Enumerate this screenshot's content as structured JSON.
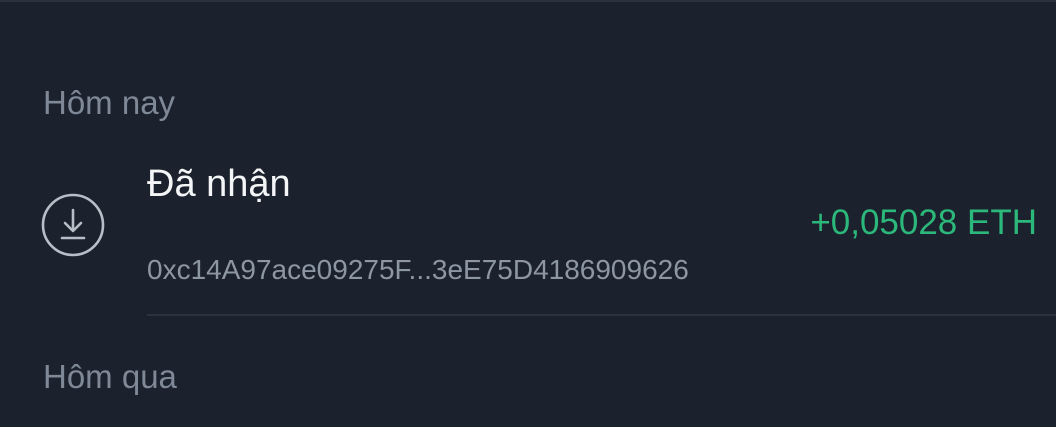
{
  "sections": {
    "today": "Hôm nay",
    "yesterday": "Hôm qua"
  },
  "transaction": {
    "type": "Đã nhận",
    "address": "0xc14A97ace09275F...3eE75D4186909626",
    "amount": "+0,05028 ETH",
    "icon": "download-circle-icon"
  },
  "colors": {
    "background": "#1b222d",
    "amount_positive": "#2cb87a",
    "muted_text": "#7f8896"
  }
}
